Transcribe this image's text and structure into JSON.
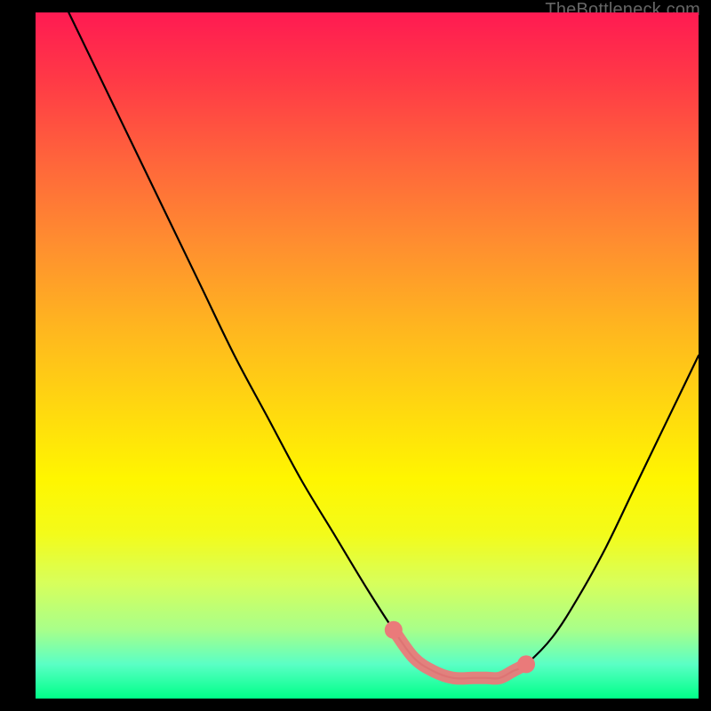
{
  "watermark": "TheBottleneck.com",
  "colors": {
    "background": "#000000",
    "gradient_top": "#ff1a52",
    "gradient_bottom": "#00ff88",
    "curve": "#000000",
    "plateau_stroke": "#ea7a7a",
    "plateau_dot_fill": "#d66"
  },
  "chart_data": {
    "type": "line",
    "title": "",
    "xlabel": "",
    "ylabel": "",
    "xlim": [
      0,
      100
    ],
    "ylim": [
      0,
      100
    ],
    "grid": false,
    "legend": null,
    "annotations": [],
    "series": [
      {
        "name": "bottleneck-curve",
        "x": [
          5,
          10,
          15,
          20,
          25,
          30,
          35,
          40,
          45,
          50,
          54,
          57,
          60,
          63,
          66,
          68,
          70,
          72,
          74,
          78,
          82,
          86,
          90,
          94,
          98,
          100
        ],
        "y": [
          100,
          90,
          80,
          70,
          60,
          50,
          41,
          32,
          24,
          16,
          10,
          6,
          4,
          3,
          3,
          3,
          3,
          4,
          5,
          9,
          15,
          22,
          30,
          38,
          46,
          50
        ]
      }
    ],
    "plateau": {
      "x": [
        54,
        57,
        60,
        63,
        66,
        68,
        70,
        72,
        74
      ],
      "y": [
        10,
        6,
        4,
        3,
        3,
        3,
        3,
        4,
        5
      ]
    },
    "notes": "Values are estimated visually; axes are unlabeled. y≈0 at bottom, y≈100 at top; x≈0 at left, x≈100 at right."
  }
}
